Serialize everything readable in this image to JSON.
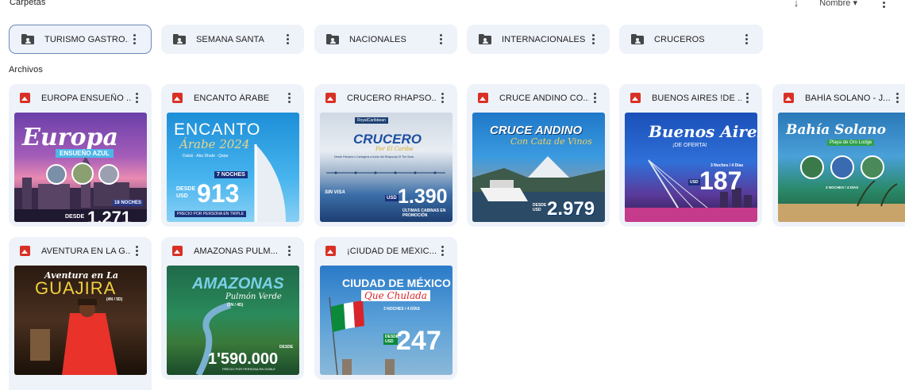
{
  "sections": {
    "folders_label": "Carpetas",
    "files_label": "Archivos"
  },
  "sort": {
    "label": "Nombre ▾"
  },
  "folders": [
    {
      "name": "TURISMO GASTRO..."
    },
    {
      "name": "SEMANA SANTA"
    },
    {
      "name": "NACIONALES"
    },
    {
      "name": "INTERNACIONALES"
    },
    {
      "name": "CRUCEROS"
    }
  ],
  "files": [
    {
      "name": "EUROPA ENSUEÑO ...",
      "thumb": {
        "title": "Europa",
        "subtitle": "ENSUEÑO AZUL",
        "badge": "18 NOCHES",
        "price_label": "DESDE",
        "price": "1.271"
      }
    },
    {
      "name": "ENCANTO ÁRABE",
      "thumb": {
        "title": "ENCANTO",
        "subtitle": "Árabe 2024",
        "tagline": "Dubái · Abu Dhabi · Qatar",
        "badge": "7 NOCHES",
        "price_label": "DESDE USD",
        "price": "913",
        "caption": "PRECIO POR PERSONA EN TRIPLE"
      }
    },
    {
      "name": "CRUCERO RHAPSO...",
      "thumb": {
        "logo": "RoyalCaribbean",
        "title": "CRUCERO",
        "subtitle": "Por El Caribe",
        "tagline": "Desde Panamá o Cartagena a bordo del Rhapsody Of The Seas",
        "badge": "SIN VISA",
        "price_label": "USD",
        "price": "1.390",
        "caption": "ÚLTIMAS CABINAS EN PROMOCIÓN"
      }
    },
    {
      "name": "CRUCE ANDINO CO...",
      "thumb": {
        "title": "CRUCE ANDINO",
        "subtitle": "Con Cata de Vinos",
        "price_label": "DESDE USD",
        "price": "2.979"
      }
    },
    {
      "name": "BUENOS AIRES !DE ...",
      "thumb": {
        "title": "Buenos Aires",
        "subtitle": "¡DE OFERTA!",
        "badge": "3 Noches / 4 Días",
        "price_label": "USD",
        "price": "187"
      }
    },
    {
      "name": "BAHÍA SOLANO - J...",
      "thumb": {
        "title": "Bahía Solano",
        "subtitle": "Playa de Oro Lodge",
        "badge": "3 NOCHES / 4 DÍAS"
      }
    },
    {
      "name": "AVENTURA EN LA G...",
      "thumb": {
        "title": "Aventura en La",
        "subtitle": "GUAJIRA",
        "badge": "(4N / 5D)"
      }
    },
    {
      "name": "AMAZONAS PULM...",
      "thumb": {
        "title": "AMAZONAS",
        "subtitle": "Pulmón Verde",
        "badge": "(3N / 4D)",
        "price_label": "DESDE",
        "price": "1'590.000",
        "caption": "PRECIO POR PERSONA EN DOBLE"
      }
    },
    {
      "name": "¡CIUDAD DE MÉXIC...",
      "thumb": {
        "title": "CIUDAD DE MÉXICO",
        "subtitle": "Que Chulada",
        "badge": "3 NOCHES / 4 DÍAS",
        "price_label": "DESDE USD",
        "price": "247"
      }
    }
  ],
  "colors": {
    "tile_bg": "#eef2f9",
    "selected_border": "#6e89b8",
    "image_icon": "#d93025",
    "folder_icon": "#444746"
  }
}
